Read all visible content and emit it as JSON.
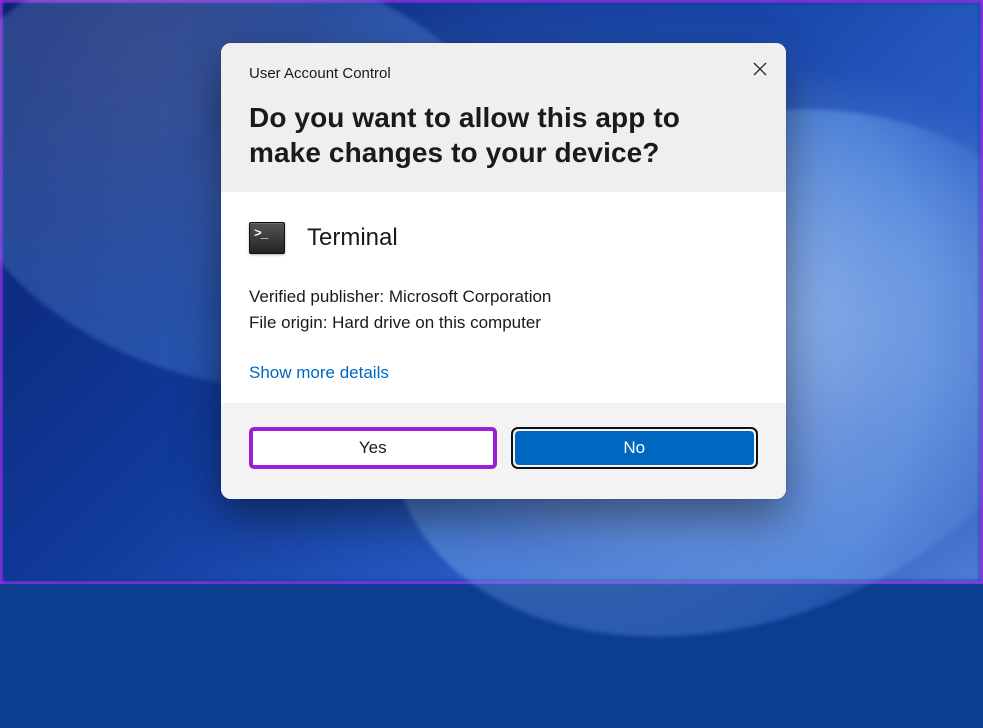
{
  "dialog": {
    "title_small": "User Account Control",
    "heading": "Do you want to allow this app to make changes to your device?",
    "app_name": "Terminal",
    "publisher_label": "Verified publisher:",
    "publisher_value": "Microsoft Corporation",
    "origin_label": "File origin:",
    "origin_value": "Hard drive on this computer",
    "details_link": "Show more details",
    "yes_label": "Yes",
    "no_label": "No"
  },
  "icons": {
    "close": "close-icon",
    "terminal": "terminal-icon"
  }
}
